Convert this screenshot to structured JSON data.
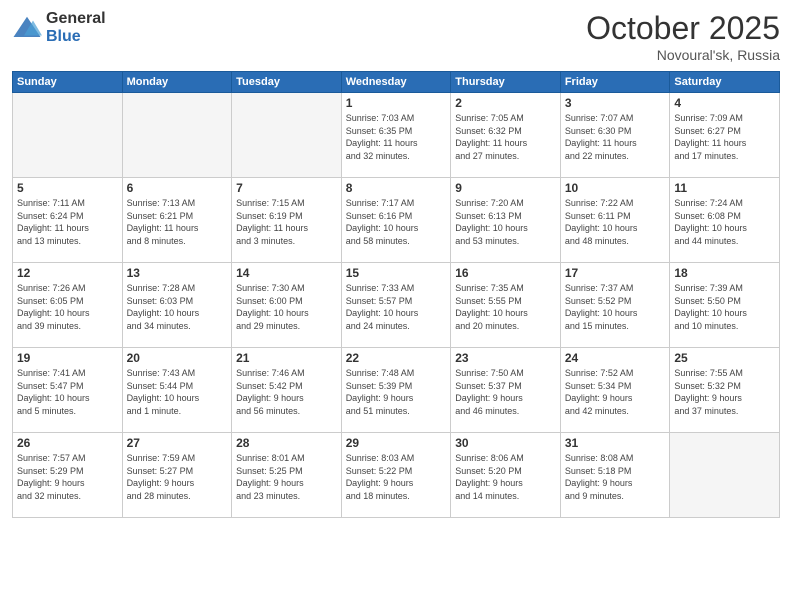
{
  "header": {
    "logo_general": "General",
    "logo_blue": "Blue",
    "month_title": "October 2025",
    "location": "Novoural'sk, Russia"
  },
  "days_of_week": [
    "Sunday",
    "Monday",
    "Tuesday",
    "Wednesday",
    "Thursday",
    "Friday",
    "Saturday"
  ],
  "weeks": [
    [
      {
        "day": "",
        "info": ""
      },
      {
        "day": "",
        "info": ""
      },
      {
        "day": "",
        "info": ""
      },
      {
        "day": "1",
        "info": "Sunrise: 7:03 AM\nSunset: 6:35 PM\nDaylight: 11 hours\nand 32 minutes."
      },
      {
        "day": "2",
        "info": "Sunrise: 7:05 AM\nSunset: 6:32 PM\nDaylight: 11 hours\nand 27 minutes."
      },
      {
        "day": "3",
        "info": "Sunrise: 7:07 AM\nSunset: 6:30 PM\nDaylight: 11 hours\nand 22 minutes."
      },
      {
        "day": "4",
        "info": "Sunrise: 7:09 AM\nSunset: 6:27 PM\nDaylight: 11 hours\nand 17 minutes."
      }
    ],
    [
      {
        "day": "5",
        "info": "Sunrise: 7:11 AM\nSunset: 6:24 PM\nDaylight: 11 hours\nand 13 minutes."
      },
      {
        "day": "6",
        "info": "Sunrise: 7:13 AM\nSunset: 6:21 PM\nDaylight: 11 hours\nand 8 minutes."
      },
      {
        "day": "7",
        "info": "Sunrise: 7:15 AM\nSunset: 6:19 PM\nDaylight: 11 hours\nand 3 minutes."
      },
      {
        "day": "8",
        "info": "Sunrise: 7:17 AM\nSunset: 6:16 PM\nDaylight: 10 hours\nand 58 minutes."
      },
      {
        "day": "9",
        "info": "Sunrise: 7:20 AM\nSunset: 6:13 PM\nDaylight: 10 hours\nand 53 minutes."
      },
      {
        "day": "10",
        "info": "Sunrise: 7:22 AM\nSunset: 6:11 PM\nDaylight: 10 hours\nand 48 minutes."
      },
      {
        "day": "11",
        "info": "Sunrise: 7:24 AM\nSunset: 6:08 PM\nDaylight: 10 hours\nand 44 minutes."
      }
    ],
    [
      {
        "day": "12",
        "info": "Sunrise: 7:26 AM\nSunset: 6:05 PM\nDaylight: 10 hours\nand 39 minutes."
      },
      {
        "day": "13",
        "info": "Sunrise: 7:28 AM\nSunset: 6:03 PM\nDaylight: 10 hours\nand 34 minutes."
      },
      {
        "day": "14",
        "info": "Sunrise: 7:30 AM\nSunset: 6:00 PM\nDaylight: 10 hours\nand 29 minutes."
      },
      {
        "day": "15",
        "info": "Sunrise: 7:33 AM\nSunset: 5:57 PM\nDaylight: 10 hours\nand 24 minutes."
      },
      {
        "day": "16",
        "info": "Sunrise: 7:35 AM\nSunset: 5:55 PM\nDaylight: 10 hours\nand 20 minutes."
      },
      {
        "day": "17",
        "info": "Sunrise: 7:37 AM\nSunset: 5:52 PM\nDaylight: 10 hours\nand 15 minutes."
      },
      {
        "day": "18",
        "info": "Sunrise: 7:39 AM\nSunset: 5:50 PM\nDaylight: 10 hours\nand 10 minutes."
      }
    ],
    [
      {
        "day": "19",
        "info": "Sunrise: 7:41 AM\nSunset: 5:47 PM\nDaylight: 10 hours\nand 5 minutes."
      },
      {
        "day": "20",
        "info": "Sunrise: 7:43 AM\nSunset: 5:44 PM\nDaylight: 10 hours\nand 1 minute."
      },
      {
        "day": "21",
        "info": "Sunrise: 7:46 AM\nSunset: 5:42 PM\nDaylight: 9 hours\nand 56 minutes."
      },
      {
        "day": "22",
        "info": "Sunrise: 7:48 AM\nSunset: 5:39 PM\nDaylight: 9 hours\nand 51 minutes."
      },
      {
        "day": "23",
        "info": "Sunrise: 7:50 AM\nSunset: 5:37 PM\nDaylight: 9 hours\nand 46 minutes."
      },
      {
        "day": "24",
        "info": "Sunrise: 7:52 AM\nSunset: 5:34 PM\nDaylight: 9 hours\nand 42 minutes."
      },
      {
        "day": "25",
        "info": "Sunrise: 7:55 AM\nSunset: 5:32 PM\nDaylight: 9 hours\nand 37 minutes."
      }
    ],
    [
      {
        "day": "26",
        "info": "Sunrise: 7:57 AM\nSunset: 5:29 PM\nDaylight: 9 hours\nand 32 minutes."
      },
      {
        "day": "27",
        "info": "Sunrise: 7:59 AM\nSunset: 5:27 PM\nDaylight: 9 hours\nand 28 minutes."
      },
      {
        "day": "28",
        "info": "Sunrise: 8:01 AM\nSunset: 5:25 PM\nDaylight: 9 hours\nand 23 minutes."
      },
      {
        "day": "29",
        "info": "Sunrise: 8:03 AM\nSunset: 5:22 PM\nDaylight: 9 hours\nand 18 minutes."
      },
      {
        "day": "30",
        "info": "Sunrise: 8:06 AM\nSunset: 5:20 PM\nDaylight: 9 hours\nand 14 minutes."
      },
      {
        "day": "31",
        "info": "Sunrise: 8:08 AM\nSunset: 5:18 PM\nDaylight: 9 hours\nand 9 minutes."
      },
      {
        "day": "",
        "info": ""
      }
    ]
  ]
}
